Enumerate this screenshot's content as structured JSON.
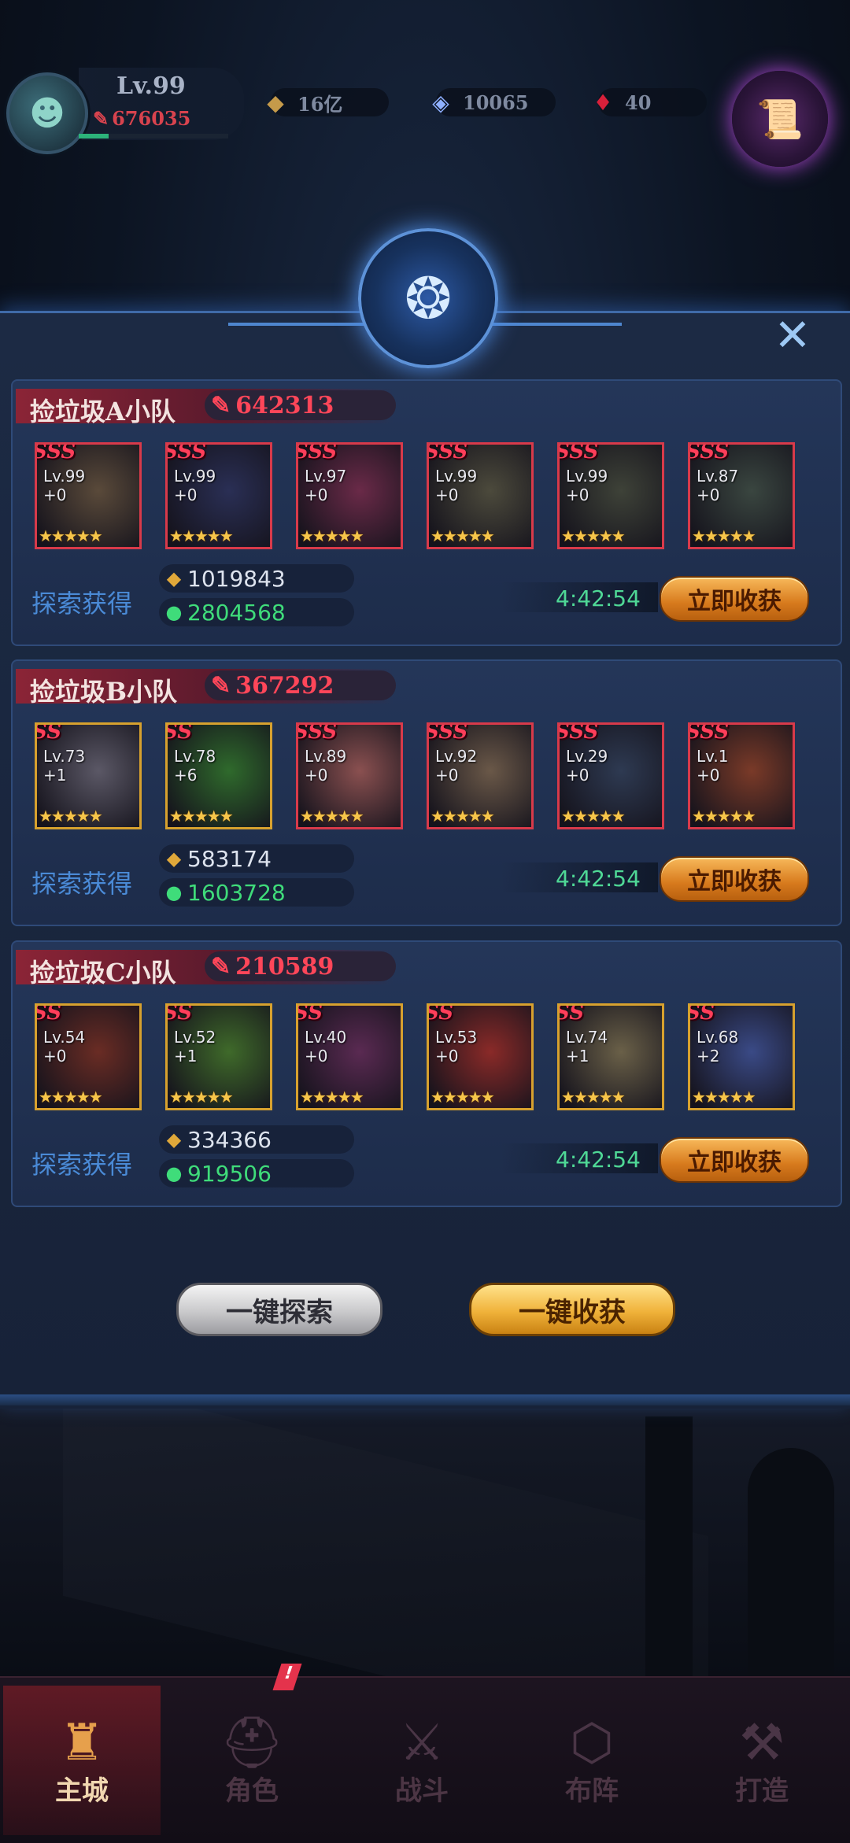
{
  "hud": {
    "level": "Lv.99",
    "power": "676035",
    "resources": [
      {
        "icon": "gold-coin-icon",
        "value": "16亿"
      },
      {
        "icon": "diamond-icon",
        "value": "10065"
      },
      {
        "icon": "red-gem-icon",
        "value": "40"
      }
    ]
  },
  "squads": [
    {
      "name": "捡垃圾A小队",
      "power": "642313",
      "heroes": [
        {
          "rank": "SSS",
          "level": "Lv.99",
          "plus": "+0",
          "frame": "red",
          "tone": "#5a4a3a"
        },
        {
          "rank": "SSS",
          "level": "Lv.99",
          "plus": "+0",
          "frame": "red",
          "tone": "#2a2f55"
        },
        {
          "rank": "SSS",
          "level": "Lv.97",
          "plus": "+0",
          "frame": "red",
          "tone": "#6a2a48"
        },
        {
          "rank": "SSS",
          "level": "Lv.99",
          "plus": "+0",
          "frame": "red",
          "tone": "#4c4a3c"
        },
        {
          "rank": "SSS",
          "level": "Lv.99",
          "plus": "+0",
          "frame": "red",
          "tone": "#3e4238"
        },
        {
          "rank": "SSS",
          "level": "Lv.87",
          "plus": "+0",
          "frame": "red",
          "tone": "#3a4640"
        }
      ],
      "loot_label": "探索获得",
      "gold": "1019843",
      "green": "2804568",
      "timer": "4:42:54",
      "collect_label": "立即收获"
    },
    {
      "name": "捡垃圾B小队",
      "power": "367292",
      "heroes": [
        {
          "rank": "SS",
          "level": "Lv.73",
          "plus": "+1",
          "frame": "gold",
          "tone": "#5b5866"
        },
        {
          "rank": "SS",
          "level": "Lv.78",
          "plus": "+6",
          "frame": "gold",
          "tone": "#2f6a2c"
        },
        {
          "rank": "SSS",
          "level": "Lv.89",
          "plus": "+0",
          "frame": "red",
          "tone": "#8a5050"
        },
        {
          "rank": "SSS",
          "level": "Lv.92",
          "plus": "+0",
          "frame": "red",
          "tone": "#6a5848"
        },
        {
          "rank": "SSS",
          "level": "Lv.29",
          "plus": "+0",
          "frame": "red",
          "tone": "#2e3a52"
        },
        {
          "rank": "SSS",
          "level": "Lv.1",
          "plus": "+0",
          "frame": "red",
          "tone": "#7a3a28"
        }
      ],
      "loot_label": "探索获得",
      "gold": "583174",
      "green": "1603728",
      "timer": "4:42:54",
      "collect_label": "立即收获"
    },
    {
      "name": "捡垃圾C小队",
      "power": "210589",
      "heroes": [
        {
          "rank": "SS",
          "level": "Lv.54",
          "plus": "+0",
          "frame": "gold",
          "tone": "#6a2c24"
        },
        {
          "rank": "SS",
          "level": "Lv.52",
          "plus": "+1",
          "frame": "gold",
          "tone": "#3f6a2a"
        },
        {
          "rank": "SS",
          "level": "Lv.40",
          "plus": "+0",
          "frame": "gold",
          "tone": "#5a2a52"
        },
        {
          "rank": "SS",
          "level": "Lv.53",
          "plus": "+0",
          "frame": "gold",
          "tone": "#8a2a28"
        },
        {
          "rank": "SS",
          "level": "Lv.74",
          "plus": "+1",
          "frame": "gold",
          "tone": "#6a6048"
        },
        {
          "rank": "SS",
          "level": "Lv.68",
          "plus": "+2",
          "frame": "gold",
          "tone": "#3a4a86"
        }
      ],
      "loot_label": "探索获得",
      "gold": "334366",
      "green": "919506",
      "timer": "4:42:54",
      "collect_label": "立即收获"
    }
  ],
  "actions": {
    "explore_all": "一键探索",
    "harvest_all": "一键收获"
  },
  "nav": [
    {
      "label": "主城",
      "icon": "castle-icon",
      "active": true
    },
    {
      "label": "角色",
      "icon": "helmet-icon",
      "active": false
    },
    {
      "label": "战斗",
      "icon": "crossed-swords-icon",
      "active": false
    },
    {
      "label": "布阵",
      "icon": "formation-icon",
      "active": false
    },
    {
      "label": "打造",
      "icon": "anvil-icon",
      "active": false
    }
  ],
  "nav_badge": "!",
  "colors": {
    "power_red": "#ff4659",
    "green_resource": "#3fdc7a",
    "timer_green": "#4fd896",
    "collect_orange": "#d77a1d"
  }
}
